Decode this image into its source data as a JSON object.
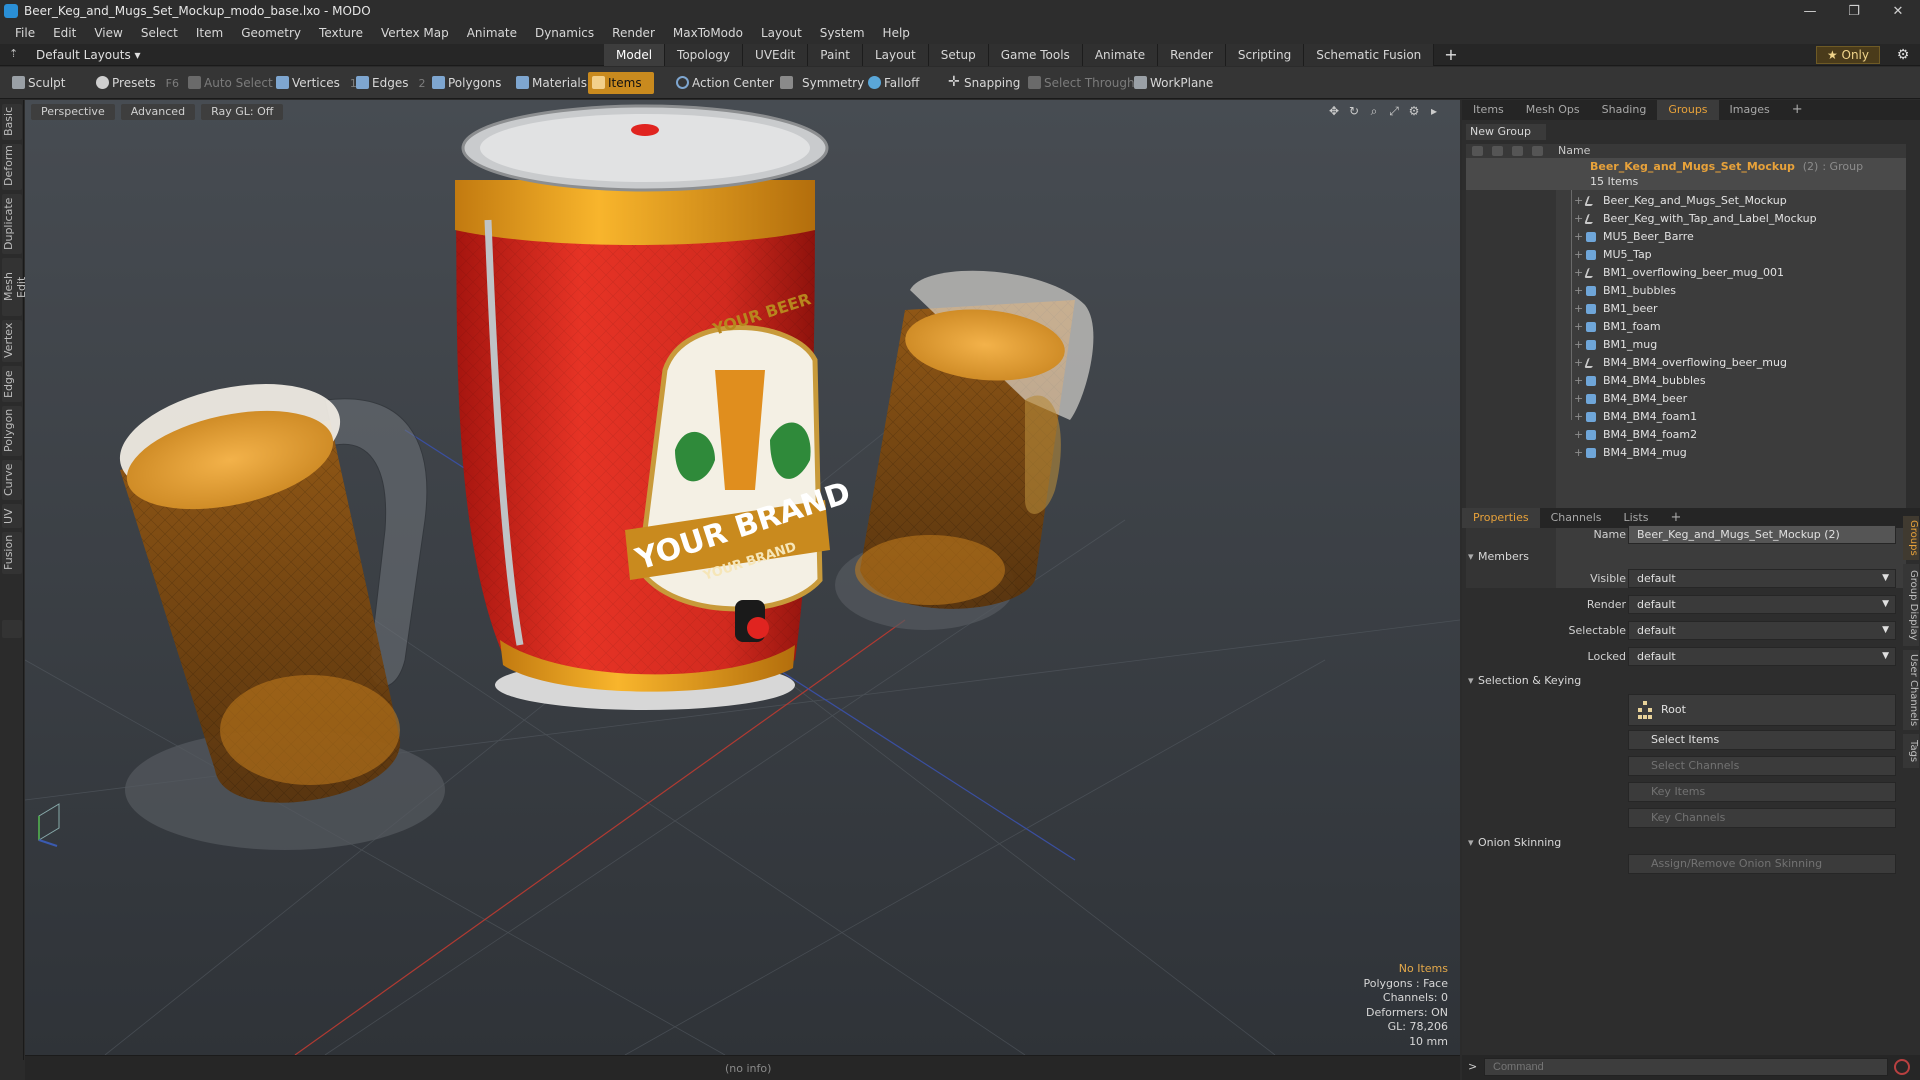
{
  "window": {
    "title": "Beer_Keg_and_Mugs_Set_Mockup_modo_base.lxo - MODO",
    "minimize": "—",
    "maximize": "❐",
    "close": "✕"
  },
  "menu": [
    "File",
    "Edit",
    "View",
    "Select",
    "Item",
    "Geometry",
    "Texture",
    "Vertex Map",
    "Animate",
    "Dynamics",
    "Render",
    "MaxToModo",
    "Layout",
    "System",
    "Help"
  ],
  "layoutbar": {
    "layout_select": "Default Layouts ▾",
    "tabs": [
      "Model",
      "Topology",
      "UVEdit",
      "Paint",
      "Layout",
      "Setup",
      "Game Tools",
      "Animate",
      "Render",
      "Scripting",
      "Schematic Fusion"
    ],
    "active_tab": "Model",
    "plus": "+",
    "only": "★ Only"
  },
  "toolbar": {
    "sculpt": "Sculpt",
    "presets": "Presets",
    "presets_key": "F6",
    "auto_select": "Auto Select",
    "vertices": "Vertices",
    "vertices_count": "1",
    "edges": "Edges",
    "edges_count": "2",
    "polygons": "Polygons",
    "materials": "Materials",
    "items": "Items",
    "action_center": "Action Center",
    "symmetry": "Symmetry",
    "falloff": "Falloff",
    "snapping": "Snapping",
    "select_through": "Select Through",
    "workplane": "WorkPlane"
  },
  "left_tabs": [
    "Basic",
    "Deform",
    "Duplicate",
    "Mesh Edit",
    "Vertex",
    "Edge",
    "Polygon",
    "Curve",
    "UV",
    "Fusion"
  ],
  "viewport": {
    "view_mode": "Perspective",
    "shading": "Advanced",
    "raygl": "Ray GL: Off",
    "info": {
      "selection": "No Items",
      "polygons": "Polygons : Face",
      "channels": "Channels: 0",
      "deformers": "Deformers: ON",
      "gl": "GL: 78,206",
      "unit": "10 mm"
    },
    "label_top": "YOUR BEER",
    "label_brand": "YOUR BRAND",
    "label_brand2": "YOUR BRAND"
  },
  "status": {
    "info": "(no info)"
  },
  "outliner": {
    "tabs": [
      "Items",
      "Mesh Ops",
      "Shading",
      "Groups",
      "Images",
      "+"
    ],
    "active_tab": "Groups",
    "new_group": "New Group",
    "col_name": "Name",
    "group_name": "Beer_Keg_and_Mugs_Set_Mockup",
    "group_suffix": "(2)",
    "group_tag": ": Group",
    "group_count": "15 Items",
    "items": [
      {
        "name": "Beer_Keg_and_Mugs_Set_Mockup",
        "type": "loc"
      },
      {
        "name": "Beer_Keg_with_Tap_and_Label_Mockup",
        "type": "loc"
      },
      {
        "name": "MU5_Beer_Barre",
        "type": "mesh"
      },
      {
        "name": "MU5_Tap",
        "type": "mesh"
      },
      {
        "name": "BM1_overflowing_beer_mug_001",
        "type": "loc"
      },
      {
        "name": "BM1_bubbles",
        "type": "mesh"
      },
      {
        "name": "BM1_beer",
        "type": "mesh"
      },
      {
        "name": "BM1_foam",
        "type": "mesh"
      },
      {
        "name": "BM1_mug",
        "type": "mesh"
      },
      {
        "name": "BM4_BM4_overflowing_beer_mug",
        "type": "loc"
      },
      {
        "name": "BM4_BM4_bubbles",
        "type": "mesh"
      },
      {
        "name": "BM4_BM4_beer",
        "type": "mesh"
      },
      {
        "name": "BM4_BM4_foam1",
        "type": "mesh"
      },
      {
        "name": "BM4_BM4_foam2",
        "type": "mesh"
      },
      {
        "name": "BM4_BM4_mug",
        "type": "mesh"
      }
    ]
  },
  "properties": {
    "tabs": [
      "Properties",
      "Channels",
      "Lists",
      "+"
    ],
    "active_tab": "Properties",
    "name_label": "Name",
    "name_value": "Beer_Keg_and_Mugs_Set_Mockup (2)",
    "members_section": "Members",
    "visible_label": "Visible",
    "visible_value": "default",
    "render_label": "Render",
    "render_value": "default",
    "selectable_label": "Selectable",
    "selectable_value": "default",
    "locked_label": "Locked",
    "locked_value": "default",
    "selection_section": "Selection & Keying",
    "root": "Root",
    "select_items": "Select Items",
    "select_channels": "Select Channels",
    "key_items": "Key Items",
    "key_channels": "Key Channels",
    "onion_section": "Onion Skinning",
    "assign_onion": "Assign/Remove Onion Skinning",
    "side_tabs": [
      "Groups",
      "Group Display",
      "User Channels",
      "Tags"
    ]
  },
  "command": {
    "prompt": ">",
    "placeholder": "Command"
  },
  "colors": {
    "accent": "#e8a23a",
    "items_active": "#c98a1e",
    "keg_red": "#d92a20"
  }
}
